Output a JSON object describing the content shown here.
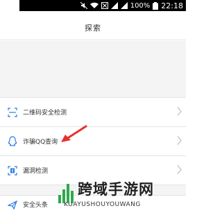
{
  "status_bar": {
    "battery": "100%",
    "time": "22:18"
  },
  "header": {
    "title": "探索"
  },
  "menu": {
    "items": [
      {
        "label": "二维码安全检测",
        "icon": "qr-scan-icon"
      },
      {
        "label": "诈骗QQ查询",
        "icon": "qq-penguin-icon"
      },
      {
        "label": "漏洞检测",
        "icon": "shield-scan-icon"
      }
    ],
    "partial_item": {
      "label": "安全头条",
      "icon": "paper-plane-icon"
    }
  },
  "watermark": {
    "cn": "跨域手游网",
    "en": "KUAYUSHOUYOUWANG"
  },
  "colors": {
    "accent": "#2b7be0",
    "arrow": "#e8302a",
    "divider": "#e3e3e3",
    "background_gray": "#f4f4f4"
  }
}
